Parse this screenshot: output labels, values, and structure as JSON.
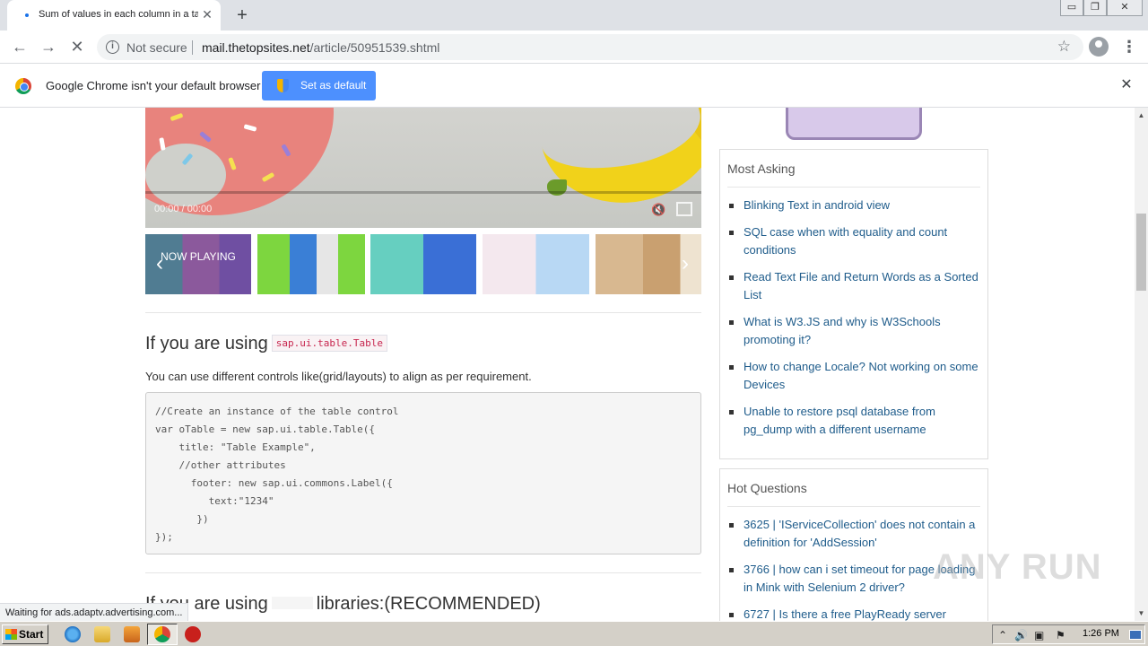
{
  "browser": {
    "tab_title": "Sum of values in each column in a table",
    "tab_close": "✕",
    "new_tab": "+",
    "security_label": "Not secure",
    "url_host": "mail.thetopsites.net",
    "url_path": "/article/50951539.shtml",
    "window_controls": [
      "▭",
      "❐",
      "✕"
    ]
  },
  "infobar": {
    "message": "Google Chrome isn't your default browser",
    "button_label": "Set as default",
    "close": "✕"
  },
  "video": {
    "time": "00:00 / 00:00",
    "now_playing": "NOW PLAYING",
    "thumbnails": [
      {
        "colors": [
          "#5bb0a0",
          "#b57ab0",
          "#8a6bb8"
        ]
      },
      {
        "colors": [
          "#7dd63f",
          "#d44",
          "#e6e6e6"
        ]
      },
      {
        "colors": [
          "#66cfc0",
          "#3a6fd6",
          "#c84a6a"
        ]
      },
      {
        "colors": [
          "#f0d0e8",
          "#b8d8f4",
          "#8fa6e0"
        ]
      },
      {
        "colors": [
          "#d8b890",
          "#c9a070",
          "#eee3d0"
        ]
      }
    ]
  },
  "article": {
    "heading_prefix": "If you are using",
    "heading_code": "sap.ui.table.Table",
    "paragraph": "You can use different controls like(grid/layouts) to align as per requirement.",
    "code": "//Create an instance of the table control\nvar oTable = new sap.ui.table.Table({\n    title: \"Table Example\",\n    //other attributes\n      footer: new sap.ui.commons.Label({\n         text:\"1234\"\n       })\n});",
    "next_heading_prefix": "If you are using",
    "next_heading_suffix": "libraries:(RECOMMENDED)"
  },
  "sidebar": {
    "most_asking": {
      "title": "Most Asking",
      "items": [
        "Blinking Text in android view",
        "SQL case when with equality and count conditions",
        "Read Text File and Return Words as a Sorted List",
        "What is W3.JS and why is W3Schools promoting it?",
        "How to change Locale? Not working on some Devices",
        "Unable to restore psql database from pg_dump with a different username"
      ]
    },
    "hot_questions": {
      "title": "Hot Questions",
      "items": [
        "3625 | 'IServiceCollection' does not contain a definition for 'AddSession'",
        "3766 | how can i set timeout for page loading in Mink with Selenium 2 driver?",
        "6727 | Is there a free PlayReady server"
      ]
    }
  },
  "status_text": "Waiting for ads.adaptv.advertising.com...",
  "watermark": "ANY RUN",
  "taskbar": {
    "start_label": "Start",
    "clock": "1:26 PM"
  }
}
